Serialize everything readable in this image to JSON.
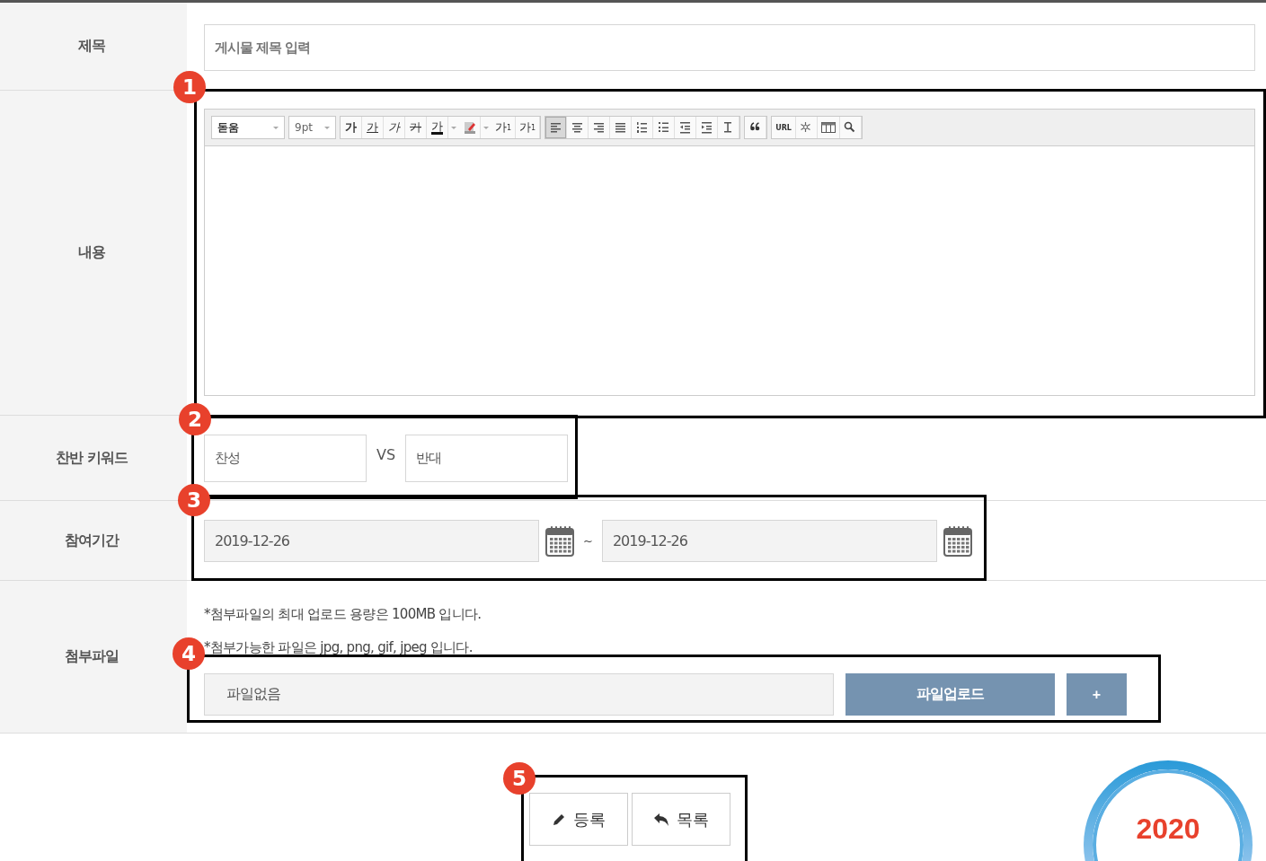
{
  "form": {
    "rows": [
      {
        "kind": "title",
        "label": "제목",
        "placeholder": "게시물 제목 입력"
      },
      {
        "kind": "editor",
        "label": "내용"
      },
      {
        "kind": "keywords",
        "label": "찬반 키워드",
        "pro": "찬성",
        "separator": "VS",
        "con": "반대"
      },
      {
        "kind": "period",
        "label": "참여기간",
        "start": "2019-12-26",
        "tilde": "~",
        "end": "2019-12-26"
      },
      {
        "kind": "file",
        "label": "첨부파일",
        "notes": [
          "*첨부파일의 최대 업로드 용량은 100MB 입니다.",
          "*첨부가능한 파일은 jpg, png, gif, jpeg 입니다."
        ],
        "file_name": "파일없음",
        "upload": "파일업로드",
        "add": "+"
      }
    ]
  },
  "editor": {
    "toolbar": [
      [
        {
          "kind": "select",
          "label": "돋움"
        }
      ],
      [
        {
          "kind": "select",
          "label": "9pt"
        }
      ],
      [
        {
          "kind": "bold",
          "label": "가"
        },
        {
          "kind": "underline",
          "label": "가"
        },
        {
          "kind": "italic",
          "label": "가"
        },
        {
          "kind": "strike",
          "label": "가"
        },
        {
          "kind": "fontcolor",
          "label": "가"
        },
        {
          "kind": "highlight"
        },
        {
          "kind": "superscript",
          "label": "가",
          "mark": "1"
        },
        {
          "kind": "subscript",
          "label": "가",
          "mark": "1"
        }
      ],
      [
        {
          "kind": "alignleft",
          "selected": true
        },
        {
          "kind": "aligncenter",
          "selected": false
        },
        {
          "kind": "alignright",
          "selected": false
        },
        {
          "kind": "justify",
          "selected": false
        },
        {
          "kind": "numlist"
        },
        {
          "kind": "bulletlist"
        },
        {
          "kind": "outdent"
        },
        {
          "kind": "indent"
        },
        {
          "kind": "lineheight"
        }
      ],
      [
        {
          "kind": "quote"
        }
      ],
      [
        {
          "kind": "url",
          "label": "URL"
        },
        {
          "kind": "special"
        },
        {
          "kind": "table"
        },
        {
          "kind": "find"
        }
      ]
    ]
  },
  "actions": [
    {
      "kind": "register",
      "label": "등록"
    },
    {
      "kind": "list",
      "label": "목록"
    }
  ],
  "annotations": [
    "1",
    "2",
    "3",
    "4",
    "5"
  ],
  "badge": {
    "year": "2020"
  }
}
